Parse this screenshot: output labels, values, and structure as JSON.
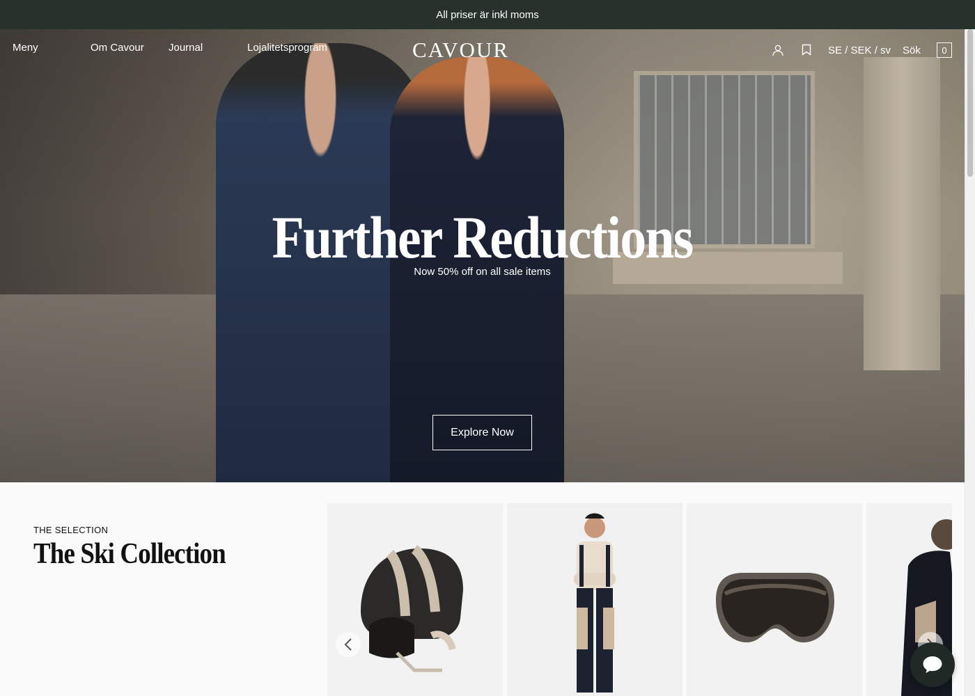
{
  "announcement": {
    "text": "All priser är inkl moms"
  },
  "nav": {
    "menu": "Meny",
    "about": "Om Cavour",
    "journal": "Journal",
    "loyalty": "Lojalitetsprogram",
    "logo": "CAVOUR",
    "locale": "SE / SEK / sv",
    "search": "Sök",
    "cart_count": "0",
    "icons": [
      "account-icon",
      "wishlist-bookmark-icon",
      "cart-icon"
    ]
  },
  "hero": {
    "title": "Further Reductions",
    "subtitle": "Now 50% off on all sale items",
    "cta": "Explore Now"
  },
  "selection": {
    "eyebrow": "THE SELECTION",
    "title": "The Ski Collection",
    "products": [
      {
        "name": "ski-helmet"
      },
      {
        "name": "ski-pants-model"
      },
      {
        "name": "ski-goggles"
      },
      {
        "name": "ski-jacket-model"
      }
    ]
  },
  "colors": {
    "announcement_bg": "#26322b",
    "chat_bg": "#1f2a26"
  }
}
